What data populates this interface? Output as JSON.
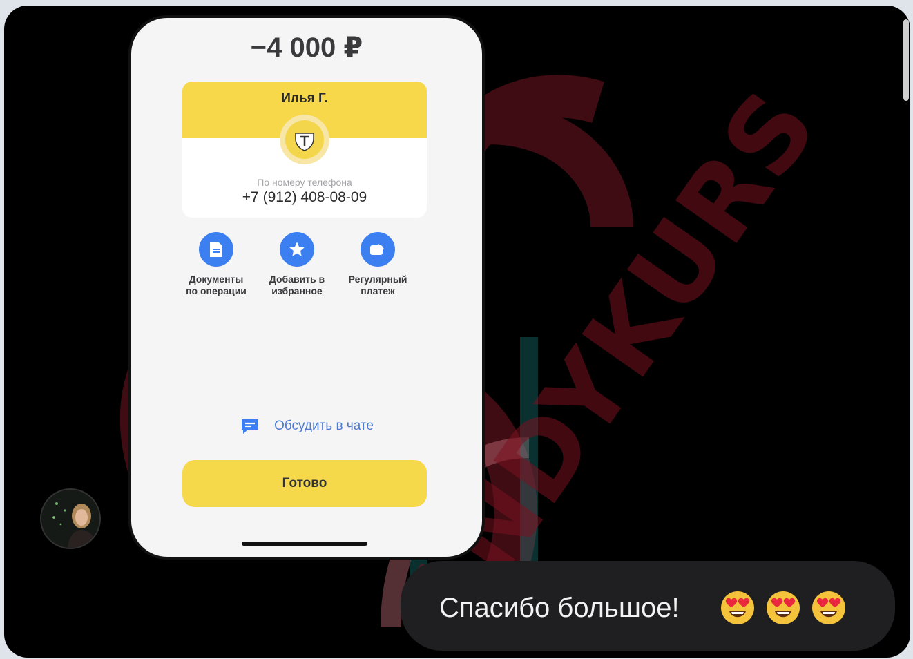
{
  "screenshot": {
    "amount": "−4 000 ₽",
    "card": {
      "recipient_name": "Илья Г.",
      "subtitle": "По номеру телефона",
      "phone": "+7 (912) 408-08-09"
    },
    "actions": [
      {
        "label": "Документы\nпо операции",
        "icon": "document-icon"
      },
      {
        "label": "Добавить в\nизбранное",
        "icon": "star-icon"
      },
      {
        "label": "Регулярный\nплатеж",
        "icon": "repeat-payment-icon"
      }
    ],
    "chat_link": {
      "label": "Обсудить в чате",
      "icon": "chat-bubble-icon"
    },
    "done_button": "Готово",
    "accent_yellow": "#f6d84a",
    "accent_blue": "#3b7ff0"
  },
  "message": {
    "text": "Спасибо большое!",
    "emojis": [
      "heart-eyes-emoji",
      "heart-eyes-emoji",
      "heart-eyes-emoji"
    ]
  },
  "watermark": {
    "text": "ANDYKURS",
    "color": "#7a1220"
  }
}
